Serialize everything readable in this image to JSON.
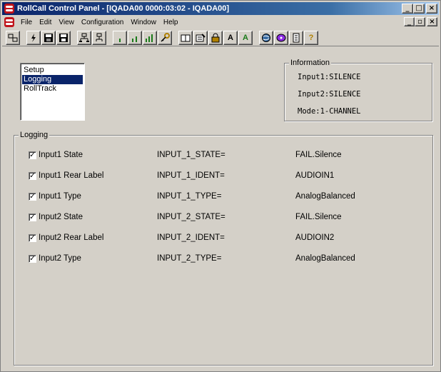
{
  "window": {
    "title": "RollCall Control Panel - [IQADA00 0000:03:02 - IQADA00]"
  },
  "menu": [
    "File",
    "Edit",
    "View",
    "Configuration",
    "Window",
    "Help"
  ],
  "toolbar_text": {
    "text_a1": "A",
    "text_a2": "A",
    "help": "?"
  },
  "tree": {
    "items": [
      "Setup",
      "Logging",
      "RollTrack"
    ],
    "selected": "Logging"
  },
  "information": {
    "title": "Information",
    "lines": [
      "Input1:SILENCE",
      "Input2:SILENCE",
      "Mode:1-CHANNEL"
    ]
  },
  "logging": {
    "title": "Logging",
    "rows": [
      {
        "checked": true,
        "label": "Input1 State",
        "key": "INPUT_1_STATE=",
        "value": "FAIL.Silence"
      },
      {
        "checked": true,
        "label": "Input1 Rear Label",
        "key": "INPUT_1_IDENT=",
        "value": "AUDIOIN1"
      },
      {
        "checked": true,
        "label": "Input1 Type",
        "key": "INPUT_1_TYPE=",
        "value": "AnalogBalanced"
      },
      {
        "checked": true,
        "label": "Input2 State",
        "key": "INPUT_2_STATE=",
        "value": "FAIL.Silence"
      },
      {
        "checked": true,
        "label": "Input2 Rear Label",
        "key": "INPUT_2_IDENT=",
        "value": "AUDIOIN2"
      },
      {
        "checked": true,
        "label": "Input2 Type",
        "key": "INPUT_2_TYPE=",
        "value": "AnalogBalanced"
      }
    ]
  },
  "colors": {
    "titlebar": "#0a246a",
    "selection": "#0a246a",
    "face": "#d4d0c8",
    "app_icon": "#c0141a"
  }
}
